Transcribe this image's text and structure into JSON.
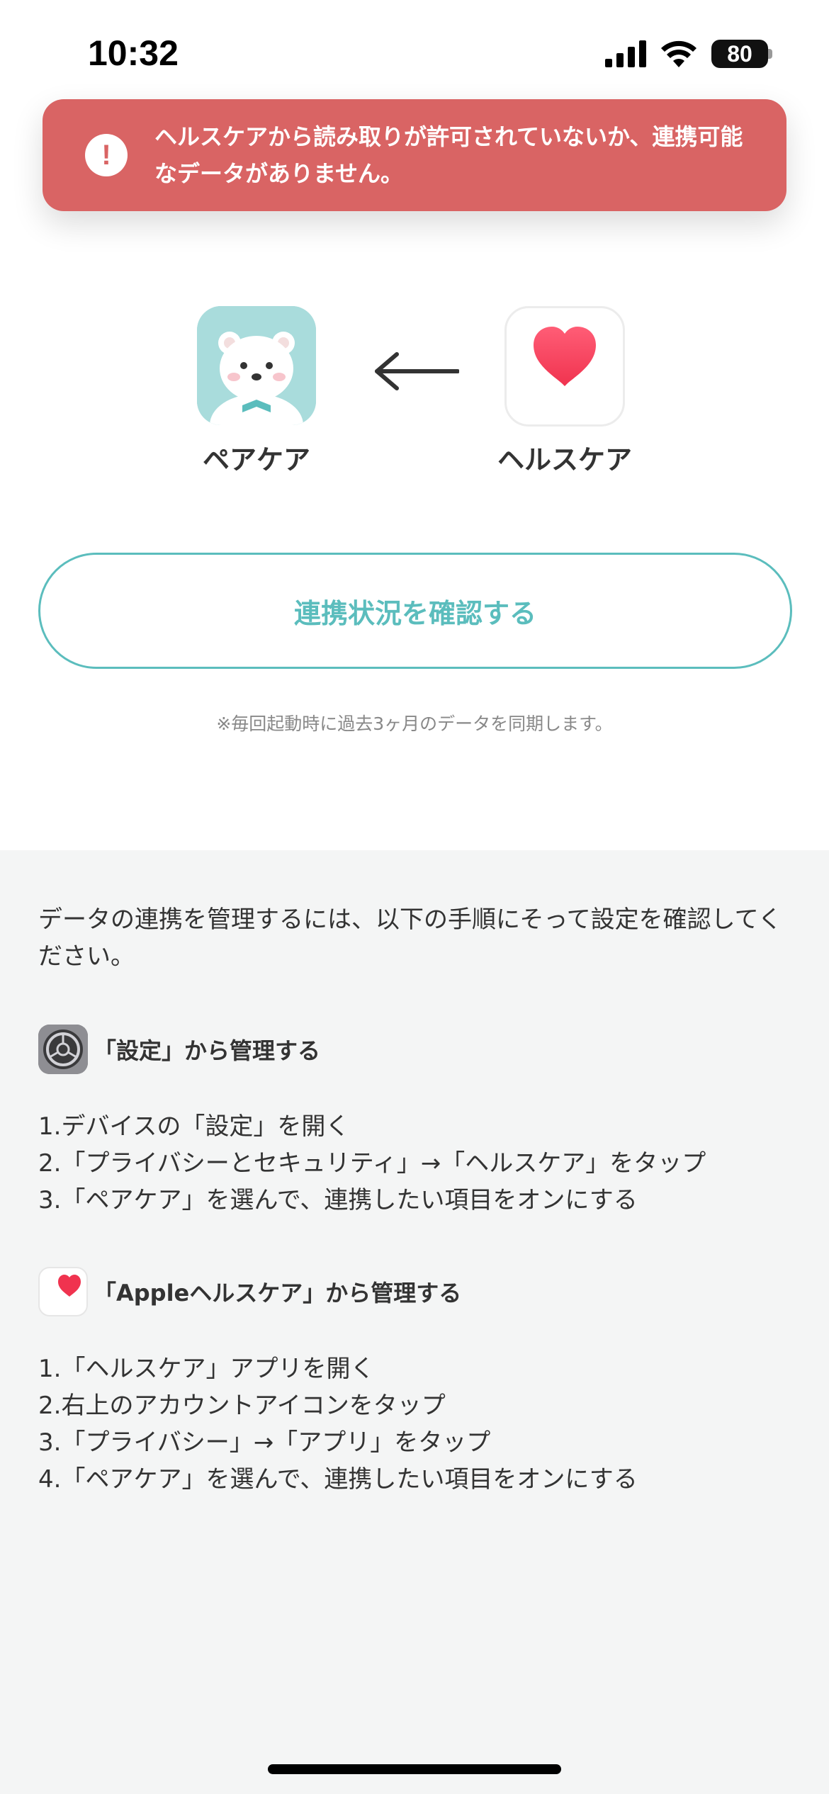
{
  "status_bar": {
    "time": "10:32",
    "battery": "80"
  },
  "toast": {
    "icon": "exclamation-icon",
    "message": "ヘルスケアから読み取りが許可されていないか、連携可能なデータがありません。"
  },
  "apps": {
    "source": {
      "label": "ペアケア",
      "icon": "polar-bear-icon"
    },
    "target": {
      "label": "ヘルスケア",
      "icon": "heart-icon"
    },
    "arrow": "left-arrow-icon"
  },
  "sync": {
    "button_label": "連携状況を確認する",
    "note": "※毎回起動時に過去3ヶ月のデータを同期します。"
  },
  "guide": {
    "intro": "データの連携を管理するには、以下の手順にそって設定を確認してください。",
    "sections": [
      {
        "icon": "settings-gear-icon",
        "title": "「設定」から管理する",
        "steps": [
          "1.デバイスの「設定」を開く",
          "2.「プライバシーとセキュリティ」→「ヘルスケア」をタップ",
          "3.「ペアケア」を選んで、連携したい項目をオンにする"
        ]
      },
      {
        "icon": "health-app-icon",
        "title": "「Appleヘルスケア」から管理する",
        "steps": [
          "1.「ヘルスケア」アプリを開く",
          "2.右上のアカウントアイコンをタップ",
          "3.「プライバシー」→「アプリ」をタップ",
          "4.「ペアケア」を選んで、連携したい項目をオンにする"
        ]
      }
    ]
  },
  "colors": {
    "toast_bg": "#d96464",
    "accent": "#5bbdbd",
    "guide_bg": "#f4f5f5",
    "heart": "#f0334f"
  }
}
